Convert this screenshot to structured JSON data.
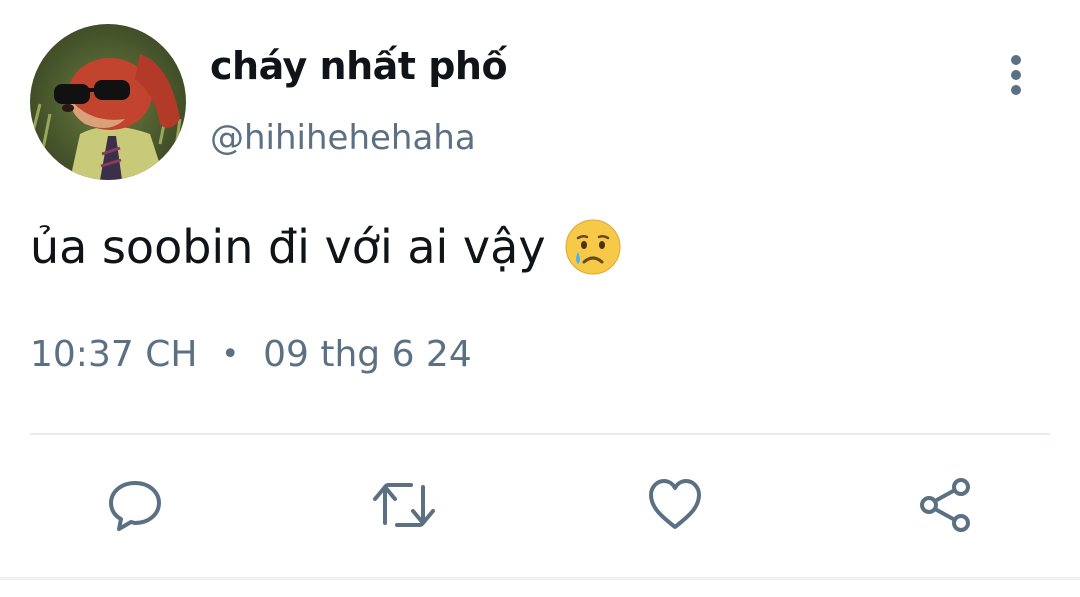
{
  "tweet": {
    "author": {
      "display_name": "cháy nhất phố",
      "handle": "@hihihehehaha",
      "avatar": "cartoon-fox-with-sunglasses-avatar"
    },
    "text": "ủa soobin đi với ai vậy",
    "emoji": "crying-face-emoji",
    "time": "10:37 CH",
    "separator": "•",
    "date": "09 thg 6 24"
  },
  "actions": [
    {
      "name": "reply",
      "icon": "comment-icon"
    },
    {
      "name": "retweet",
      "icon": "retweet-icon"
    },
    {
      "name": "like",
      "icon": "heart-icon"
    },
    {
      "name": "share",
      "icon": "share-icon"
    }
  ],
  "colors": {
    "primary_text": "#0f1419",
    "secondary_text": "#5b7083",
    "icon": "#5b7083",
    "divider": "#e7ecf0"
  }
}
